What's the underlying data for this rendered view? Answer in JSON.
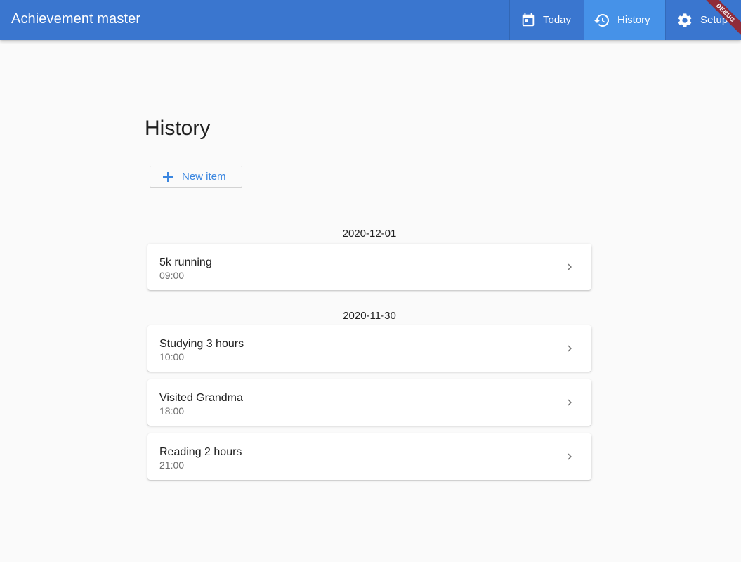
{
  "app": {
    "title": "Achievement master",
    "primary_color": "#3a76cf",
    "active_tab_color": "#4692e8",
    "debug_banner": "DEBUG"
  },
  "nav": {
    "today": {
      "label": "Today",
      "icon": "calendar-icon"
    },
    "history": {
      "label": "History",
      "icon": "history-icon",
      "active": true
    },
    "setup": {
      "label": "Setup",
      "icon": "gear-icon"
    }
  },
  "page": {
    "title": "History",
    "new_item_label": "New item"
  },
  "groups": [
    {
      "date": "2020-12-01",
      "items": [
        {
          "name": "5k running",
          "time": "09:00"
        }
      ]
    },
    {
      "date": "2020-11-30",
      "items": [
        {
          "name": "Studying 3 hours",
          "time": "10:00"
        },
        {
          "name": "Visited Grandma",
          "time": "18:00"
        },
        {
          "name": "Reading 2 hours",
          "time": "21:00"
        }
      ]
    }
  ]
}
